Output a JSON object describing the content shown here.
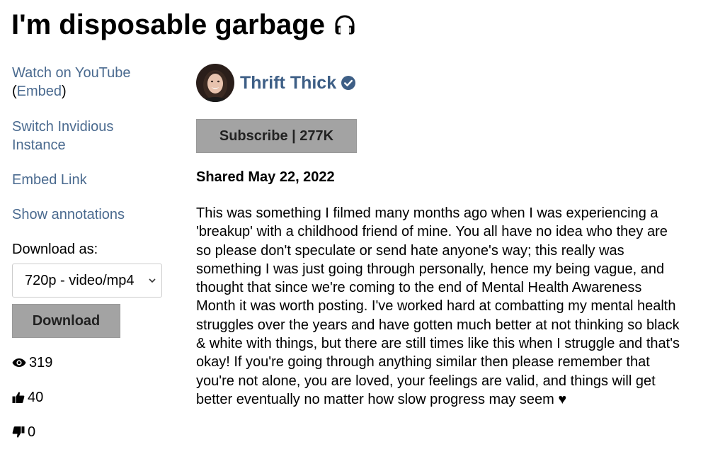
{
  "video": {
    "title": "I'm disposable garbage",
    "title_icon": "headphones-icon"
  },
  "sidebar": {
    "watch_on_youtube": "Watch on YouTube",
    "embed_open": "(",
    "embed_label": "Embed",
    "embed_close": ")",
    "switch_instance": "Switch Invidious Instance",
    "embed_link": "Embed Link",
    "show_annotations": "Show annotations",
    "download_as_label": "Download as:",
    "download_format_selected": "720p - video/mp4",
    "download_button": "Download",
    "views": "319",
    "likes": "40",
    "dislikes": "0"
  },
  "channel": {
    "name": "Thrift Thick",
    "verified": true,
    "subscribe_label": "Subscribe | 277K"
  },
  "details": {
    "shared_date": "Shared May 22, 2022",
    "description": "This was something I filmed many months ago when I was experiencing a 'breakup' with a childhood friend of mine. You all have no idea who they are so please don't speculate or send hate anyone's way; this really was something I was just going through personally, hence my being vague, and thought that since we're coming to the end of Mental Health Awareness Month it was worth posting. I've worked hard at combatting my mental health struggles over the years and have gotten much better at not thinking so black & white with things, but there are still times like this when I struggle and that's okay! If you're going through anything similar then please remember that you're not alone, you are loved, your feelings are valid, and things will get better eventually no matter how slow progress may seem ♥"
  },
  "colors": {
    "link": "#4a6a8f",
    "channel_name": "#3e5f86",
    "button_bg": "#a3a3a3",
    "verified": "#3e5f86"
  }
}
